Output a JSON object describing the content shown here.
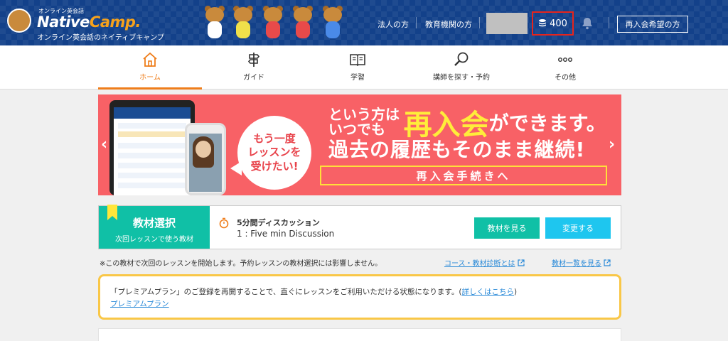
{
  "header": {
    "logo_small": "オンライン英会話",
    "logo_name_part1": "Native",
    "logo_name_part2": "Camp.",
    "logo_tagline": "オンライン英会話のネイティブキャンプ",
    "links": [
      "法人の方",
      "教育機関の方"
    ],
    "coins": "400",
    "coin_icon": "coin-stack-icon",
    "bell_icon": "bell-icon",
    "rejoin_button": "再入会希望の方",
    "brand_color": "#13418a",
    "highlight_color": "#e8241b"
  },
  "nav": {
    "items": [
      {
        "label": "ホーム",
        "icon": "home-icon",
        "active": true
      },
      {
        "label": "ガイド",
        "icon": "signpost-icon",
        "active": false
      },
      {
        "label": "学習",
        "icon": "book-icon",
        "active": false
      },
      {
        "label": "講師を探す・予約",
        "icon": "search-icon",
        "active": false
      },
      {
        "label": "その他",
        "icon": "more-icon",
        "active": false
      }
    ],
    "active_color": "#ef7d1a"
  },
  "banner": {
    "bubble_line1": "もう一度",
    "bubble_line2": "レッスンを",
    "bubble_line3": "受けたい!",
    "headline_small1": "という方は",
    "headline_small2": "いつでも",
    "headline_big": "再入会",
    "headline_tail": "ができます。",
    "headline2": "過去の履歴もそのまま継続!",
    "cta": "再入会手続きへ",
    "prev": "‹",
    "next": "›",
    "bg_color": "#f86166"
  },
  "material": {
    "left_title": "教材選択",
    "left_sub": "次回レッスンで使う教材",
    "course_title": "5分間ディスカッション",
    "lesson": "1 : Five min Discussion",
    "view_button": "教材を見る",
    "change_button": "変更する"
  },
  "note": "※この教材で次回のレッスンを開始します。予約レッスンの教材選択には影響しません。",
  "links": {
    "course_diagnosis": "コース・教材診断とは",
    "material_list": "教材一覧を見る"
  },
  "premium": {
    "text": "「プレミアムプラン」のご登録を再開することで、直ぐにレッスンをご利用いただける状態になります。(",
    "detail_link": "詳しくはこちら",
    "close_paren": ")",
    "plan_link": "プレミアムプラン"
  }
}
